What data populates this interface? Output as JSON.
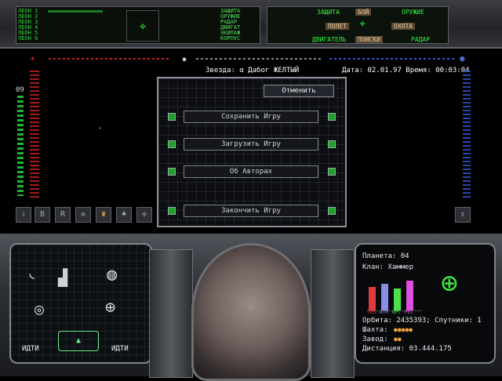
{
  "crew": [
    {
      "label": "ЛЕОН 1",
      "bar": 0.25,
      "system": "ЗАЩИТА"
    },
    {
      "label": "ЛЕОН 2",
      "bar": 0.0,
      "system": "ОРУЖИЕ"
    },
    {
      "label": "ЛЕОН 3",
      "bar": 0.0,
      "system": "РАДАР"
    },
    {
      "label": "ЛЕОН 4",
      "bar": 0.0,
      "system": "ДВИГАТ"
    },
    {
      "label": "ЛЕОН 5",
      "bar": 0.0,
      "system": "ЭКИПАЖ"
    },
    {
      "label": "ЛЕОН 6",
      "bar": 0.0,
      "system": "КОРПУС"
    }
  ],
  "status_panel": {
    "defense_label": "ЗАЩИТА",
    "fight_label": "БОЙ",
    "weapon_label": "ОРУЖИЕ",
    "flight_label": "ПОЛЕТ",
    "hunt_label": "ОХОТА",
    "engine_label": "ДВИГАТЕЛЬ",
    "travel_label": "ПОИСКИ",
    "radar_label": "РАДАР"
  },
  "header": {
    "star_label": "Звезда: α Дабог ЖЕЛТЫЙ",
    "date_label": "Дата: 02.01.97  Время: 00:03:04",
    "counter": "09"
  },
  "menu": {
    "cancel": "Отменить",
    "items": [
      "Сохранить Игру",
      "Загрузить Игру",
      "Об Авторах",
      "Закончить Игру"
    ]
  },
  "left_console": {
    "go_left": "ИДТИ",
    "go_right": "ИДТИ"
  },
  "planet": {
    "planet": "Планета: 04",
    "clan": "Клан: Хаммер",
    "orbit": "Орбита: 2435393; Спутники: 1",
    "mine": "Шахта:",
    "factory": "Завод:",
    "distance": "Дистанция: 03.444.175",
    "bars": [
      {
        "label": "ТЕМ",
        "value": 0.75,
        "color": "#e23a3a"
      },
      {
        "label": "АТМ",
        "value": 0.85,
        "color": "#8a8ce8"
      },
      {
        "label": "ОРГ",
        "value": 0.7,
        "color": "#4ee14a"
      },
      {
        "label": "РЕС",
        "value": 0.95,
        "color": "#e04ee0"
      }
    ]
  }
}
